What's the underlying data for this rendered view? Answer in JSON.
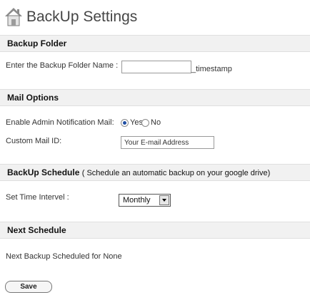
{
  "header": {
    "title": "BackUp Settings",
    "icon": "home-icon"
  },
  "sections": {
    "backup_folder": {
      "title": "Backup Folder",
      "label": "Enter the Backup Folder Name :",
      "value": "",
      "suffix": "_timestamp"
    },
    "mail_options": {
      "title": "Mail Options",
      "notification_label": "Enable Admin Notification Mail:",
      "yes_label": "Yes",
      "no_label": "No",
      "selected": "Yes",
      "mail_label": "Custom Mail ID:",
      "mail_value": "Your E-mail Address"
    },
    "schedule": {
      "title": "BackUp Schedule",
      "note": "( Schedule an automatic backup on your google drive)",
      "interval_label": "Set Time Intervel :",
      "interval_value": "Monthly"
    },
    "next_schedule": {
      "title": "Next Schedule",
      "text": "Next Backup Scheduled for None"
    }
  },
  "actions": {
    "save_label": "Save"
  }
}
